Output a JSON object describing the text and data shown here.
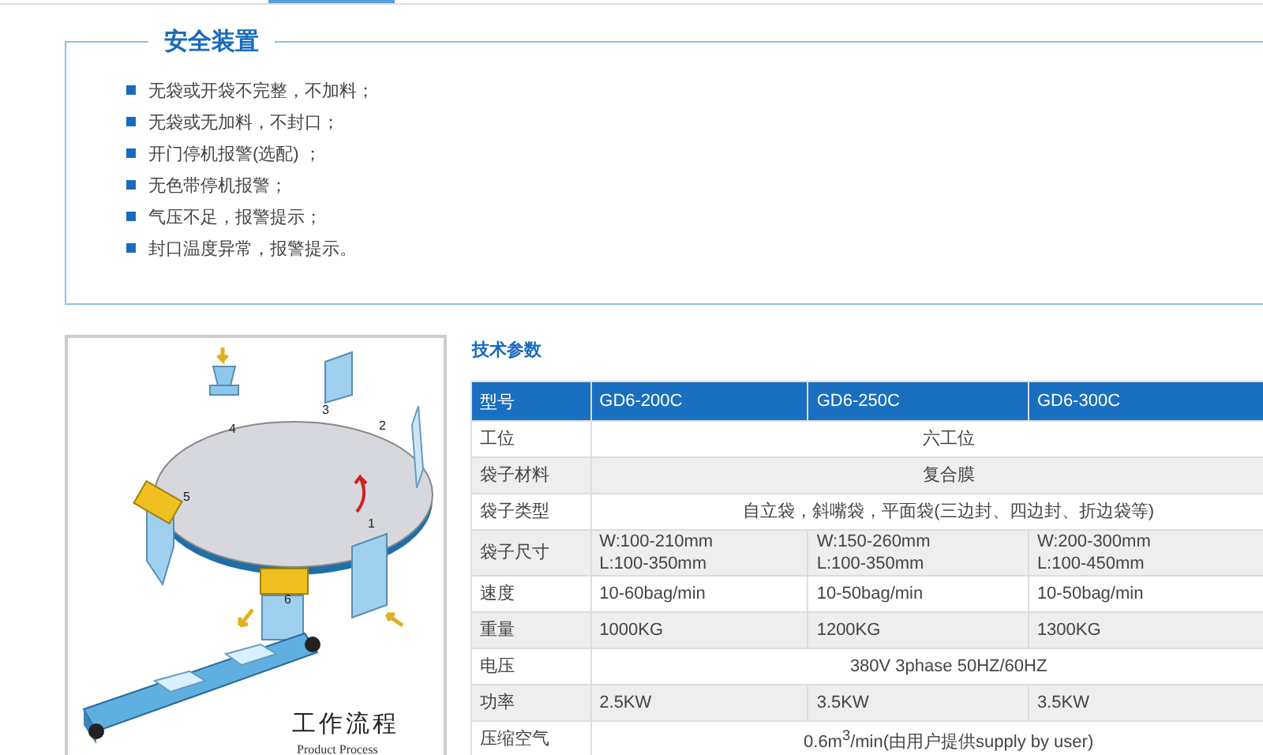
{
  "top_tabs": [
    {
      "selected": false
    },
    {
      "selected": true
    },
    {
      "selected": false
    }
  ],
  "safety": {
    "title": "安全装置",
    "items": [
      "无袋或开袋不完整，不加料；",
      "无袋或无加料，不封口；",
      "开门停机报警(选配) ；",
      "无色带停机报警；",
      "气压不足，报警提示；",
      "封口温度异常，报警提示。"
    ]
  },
  "diagram": {
    "stations": [
      "1",
      "2",
      "3",
      "4",
      "5",
      "6"
    ],
    "caption": "工作流程",
    "caption_en": "Product Process"
  },
  "specs": {
    "title": "技术参数",
    "columns": [
      "型号",
      "GD6-200C",
      "GD6-250C",
      "GD6-300C"
    ],
    "rows": [
      {
        "label": "工位",
        "values": [
          "六工位"
        ]
      },
      {
        "label": "袋子材料",
        "values": [
          "复合膜"
        ]
      },
      {
        "label": "袋子类型",
        "values": [
          "自立袋，斜嘴袋，平面袋(三边封、四边封、折边袋等)"
        ]
      },
      {
        "label": "袋子尺寸",
        "values": [
          [
            "W:100-210mm",
            "L:100-350mm"
          ],
          [
            "W:150-260mm",
            "L:100-350mm"
          ],
          [
            "W:200-300mm",
            "L:100-450mm"
          ]
        ]
      },
      {
        "label": "速度",
        "values": [
          "10-60bag/min",
          "10-50bag/min",
          "10-50bag/min"
        ]
      },
      {
        "label": "重量",
        "values": [
          "1000KG",
          "1200KG",
          "1300KG"
        ]
      },
      {
        "label": "电压",
        "values": [
          "380V 3phase 50HZ/60HZ"
        ]
      },
      {
        "label": "功率",
        "values": [
          "2.5KW",
          "3.5KW",
          "3.5KW"
        ]
      },
      {
        "label": "压缩空气",
        "values": [
          "0.6m$^{3}$/min(由用户提供supply by user)"
        ]
      }
    ]
  }
}
